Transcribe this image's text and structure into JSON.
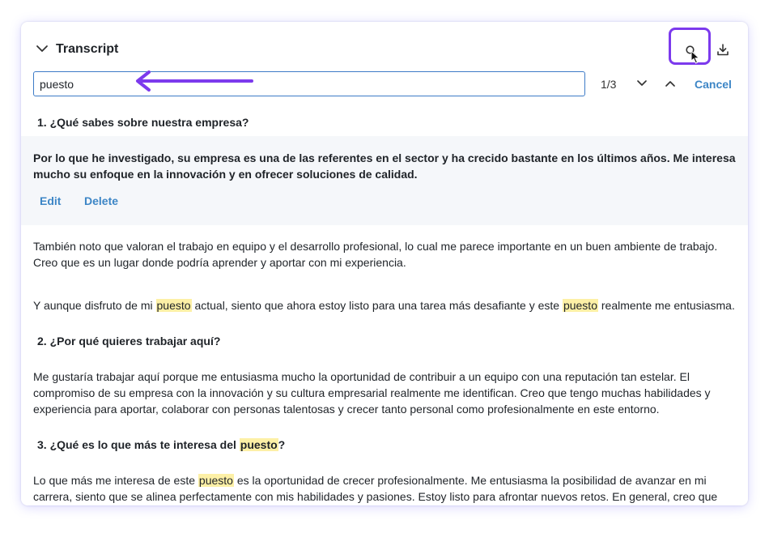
{
  "header": {
    "title": "Transcript",
    "search_icon": "search-icon",
    "download_icon": "download-icon"
  },
  "search": {
    "value": "puesto",
    "counter": "1/3",
    "cancel_label": "Cancel"
  },
  "transcript": {
    "q1": "1. ¿Qué sabes sobre nuestra empresa?",
    "selected_answer": "Por lo que he investigado, su empresa es una de las referentes en el sector y ha crecido bastante en los últimos años. Me interesa mucho su enfoque en la innovación y en ofrecer soluciones de calidad.",
    "edit_label": "Edit",
    "delete_label": "Delete",
    "p2": "También noto que valoran el trabajo en equipo y el desarrollo profesional, lo cual me parece importante en un buen ambiente de trabajo. Creo que es un lugar donde podría aprender y aportar con mi experiencia.",
    "p3_a": "Y aunque disfruto de mi ",
    "p3_mark1": "puesto",
    "p3_b": " actual, siento que ahora estoy listo para una tarea más desafiante y este ",
    "p3_mark2": "puesto",
    "p3_c": " realmente me entusiasma.",
    "q2": "2. ¿Por qué quieres trabajar aquí?",
    "p4": "Me gustaría trabajar aquí porque me entusiasma mucho la oportunidad de contribuir a un equipo con una reputación tan estelar. El compromiso de su empresa con la innovación y su cultura empresarial realmente me identifican. Creo que tengo muchas habilidades y experiencia para aportar, colaborar con personas talentosas y crecer tanto personal como profesionalmente en este entorno.",
    "q3_a": "3. ¿Qué es lo que más te interesa del ",
    "q3_mark": "puesto",
    "q3_b": "?",
    "p5_a": "Lo que más me interesa de este ",
    "p5_mark": "puesto",
    "p5_b": " es la oportunidad de crecer profesionalmente. Me entusiasma la posibilidad de avanzar en mi carrera, siento que se alinea perfectamente con mis habilidades y pasiones. Estoy listo para afrontar nuevos retos. En general, creo que este"
  },
  "colors": {
    "accent": "#7c3aed",
    "link": "#3d86c6",
    "highlight": "#fdf0a6",
    "input_border": "#3d7bc7"
  }
}
